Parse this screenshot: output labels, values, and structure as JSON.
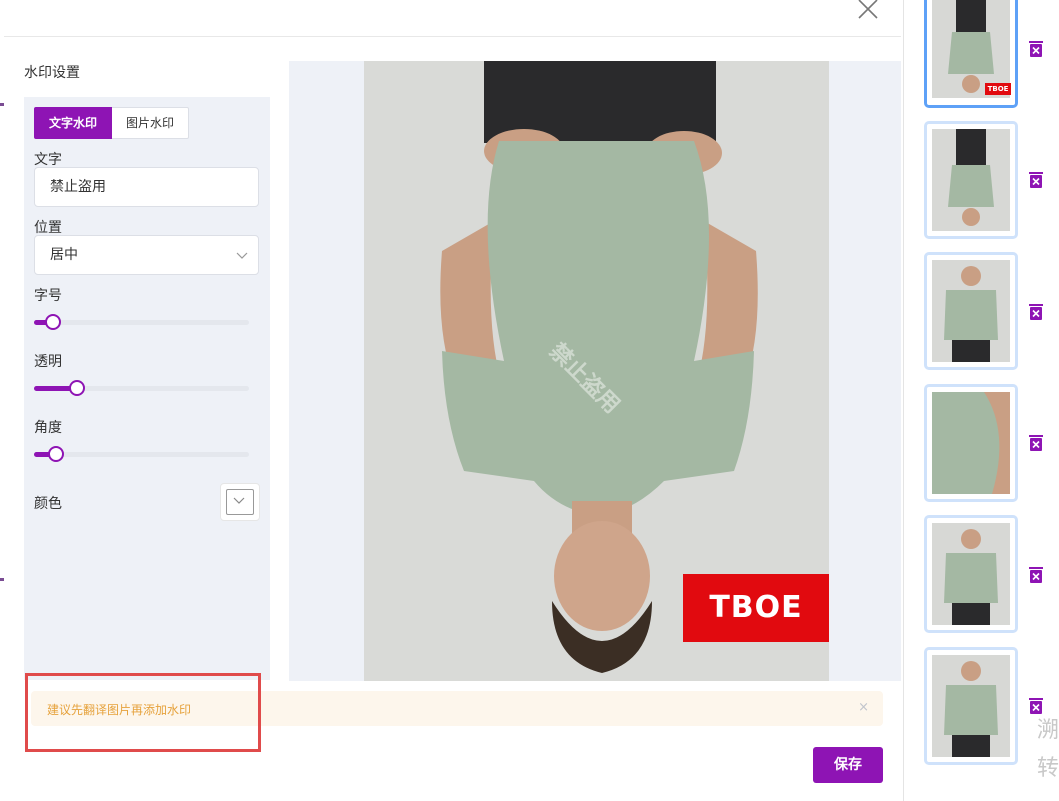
{
  "settings": {
    "title": "水印设置",
    "tabs": [
      {
        "label": "文字水印",
        "active": true
      },
      {
        "label": "图片水印",
        "active": false
      }
    ],
    "text_label": "文字",
    "text_value": "禁止盗用",
    "position_label": "位置",
    "position_value": "居中",
    "font_size_label": "字号",
    "font_size_level": 0.09,
    "opacity_label": "透明",
    "opacity_level": 0.2,
    "angle_label": "角度",
    "angle_level": 0.1,
    "color_label": "颜色"
  },
  "preview": {
    "watermark_text": "禁止盗用",
    "logo_text": "TBOE"
  },
  "alert": {
    "message": "建议先翻译图片再添加水印",
    "close_symbol": "×"
  },
  "actions": {
    "save_label": "保存"
  },
  "thumbnails": [
    {
      "name": "upside-down-front",
      "selected": true,
      "badge": "TBOE"
    },
    {
      "name": "upside-down-full",
      "selected": false
    },
    {
      "name": "front",
      "selected": false
    },
    {
      "name": "neck-detail",
      "selected": false
    },
    {
      "name": "side",
      "selected": false
    },
    {
      "name": "back",
      "selected": false
    }
  ],
  "side_text": [
    "溯",
    "转"
  ],
  "colors": {
    "accent": "#8e14b4",
    "alert_text": "#e6a23c",
    "alert_bg": "#fdf6ec",
    "logo_red": "#e10a0f",
    "shirt": "#a4b8a3",
    "highlight": "#e04b4b"
  },
  "icons": [
    "close-icon",
    "chevron-down-icon",
    "trash-icon"
  ]
}
